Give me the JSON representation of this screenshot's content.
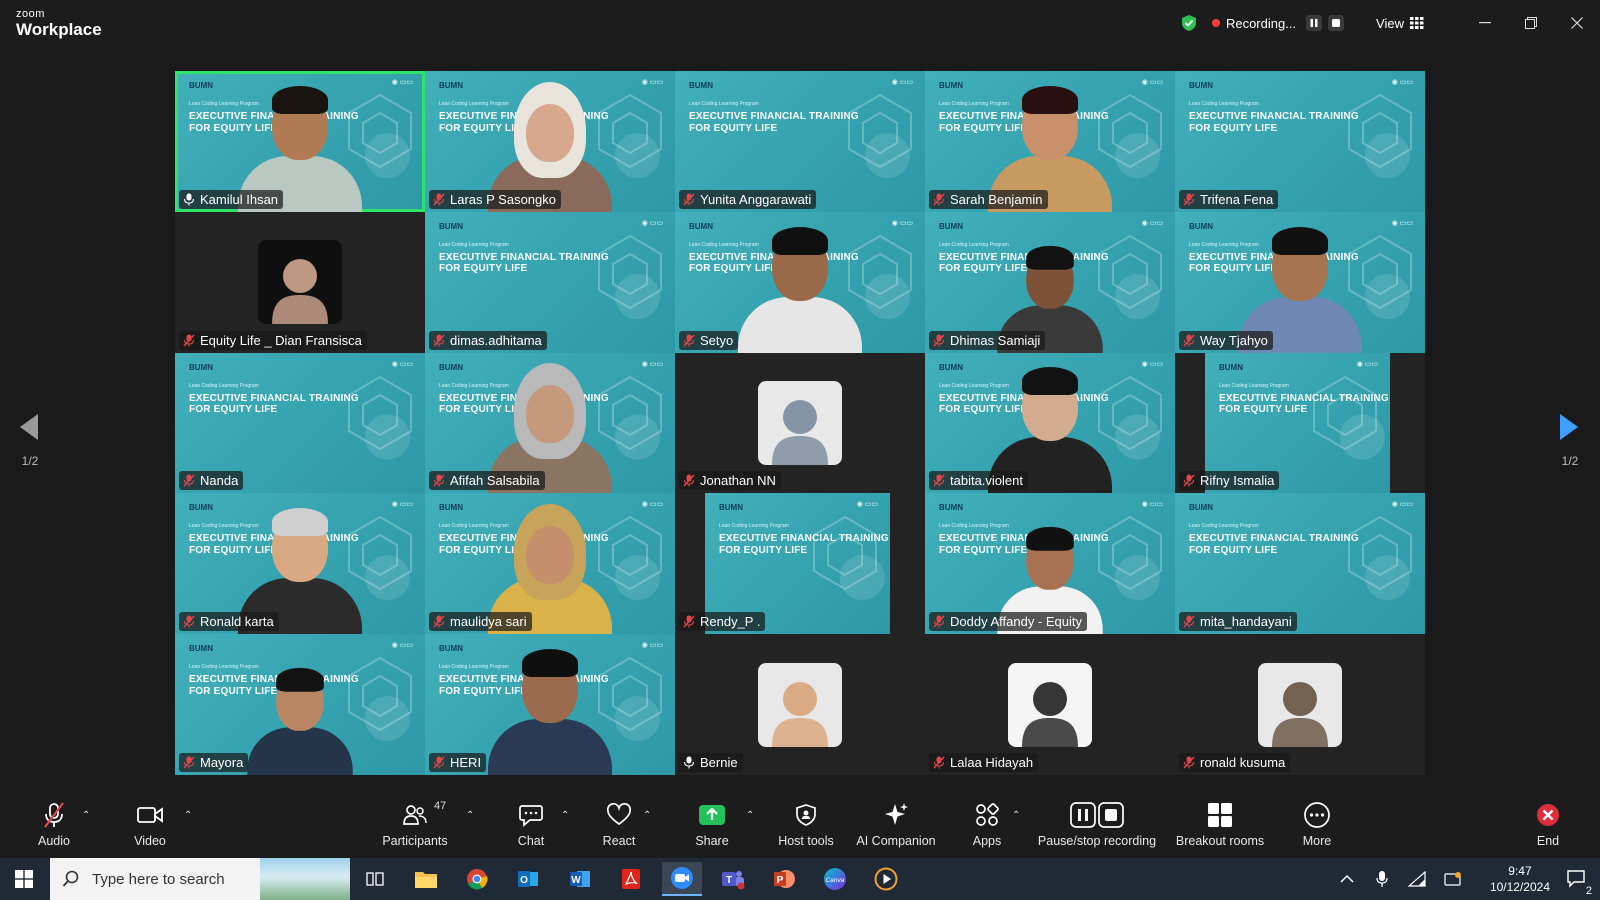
{
  "app": {
    "brand_small": "zoom",
    "brand_large": "Workplace"
  },
  "titlebar": {
    "recording_label": "Recording...",
    "view_label": "View",
    "icons": [
      "shield-check-icon",
      "pause-icon",
      "stop-icon",
      "grid-icon",
      "minimize-icon",
      "restore-icon",
      "close-icon"
    ]
  },
  "pagination": {
    "left": "1/2",
    "right": "1/2"
  },
  "slide": {
    "header": "BUMN",
    "sub": "Lean Coding Learning Program",
    "headline": "EXECUTIVE FINANCIAL TRAINING FOR EQUITY LIFE"
  },
  "participants": [
    {
      "name": "Kamilul Ihsan",
      "muted": false
    },
    {
      "name": "Laras P Sasongko",
      "muted": true
    },
    {
      "name": "Yunita Anggarawati",
      "muted": true
    },
    {
      "name": "Sarah Benjamin",
      "muted": true
    },
    {
      "name": "Trifena Fena",
      "muted": true
    },
    {
      "name": "Equity Life _ Dian Fransisca",
      "muted": true
    },
    {
      "name": "dimas.adhitama",
      "muted": true
    },
    {
      "name": "Setyo",
      "muted": true
    },
    {
      "name": "Dhimas Samiaji",
      "muted": true
    },
    {
      "name": "Way Tjahyo",
      "muted": true
    },
    {
      "name": "Nanda",
      "muted": true
    },
    {
      "name": "Afifah Salsabila",
      "muted": true
    },
    {
      "name": "Jonathan NN",
      "muted": true
    },
    {
      "name": "tabita.violent",
      "muted": true
    },
    {
      "name": "Rifny Ismalia",
      "muted": true
    },
    {
      "name": "Ronald karta",
      "muted": true
    },
    {
      "name": "maulidya sari",
      "muted": true
    },
    {
      "name": "Rendy_P .",
      "muted": true
    },
    {
      "name": "Doddy Affandy - Equity",
      "muted": true
    },
    {
      "name": "mita_handayani",
      "muted": true
    },
    {
      "name": "Mayora",
      "muted": true
    },
    {
      "name": "HERI",
      "muted": true
    },
    {
      "name": "Bernie",
      "muted": false
    },
    {
      "name": "Lalaa Hidayah",
      "muted": true
    },
    {
      "name": "ronald kusuma",
      "muted": true
    }
  ],
  "toolbar": {
    "audio": "Audio",
    "video": "Video",
    "participants": "Participants",
    "participants_count": "47",
    "chat": "Chat",
    "react": "React",
    "share": "Share",
    "host_tools": "Host tools",
    "ai_companion": "AI Companion",
    "apps": "Apps",
    "pause_stop": "Pause/stop recording",
    "breakout": "Breakout rooms",
    "more": "More",
    "end": "End"
  },
  "taskbar": {
    "search_placeholder": "Type here to search",
    "time": "9:47",
    "date": "10/12/2024",
    "notification_count": "2",
    "apps": [
      "task-view-icon",
      "file-explorer-icon",
      "chrome-icon",
      "outlook-icon",
      "word-icon",
      "acrobat-icon",
      "zoom-icon",
      "teams-icon",
      "powerpoint-icon",
      "canva-icon",
      "media-player-icon"
    ]
  },
  "colors": {
    "accent_green": "#2ee36a",
    "tile_teal": "#3aa8b5",
    "muted_red": "#e0464a"
  }
}
